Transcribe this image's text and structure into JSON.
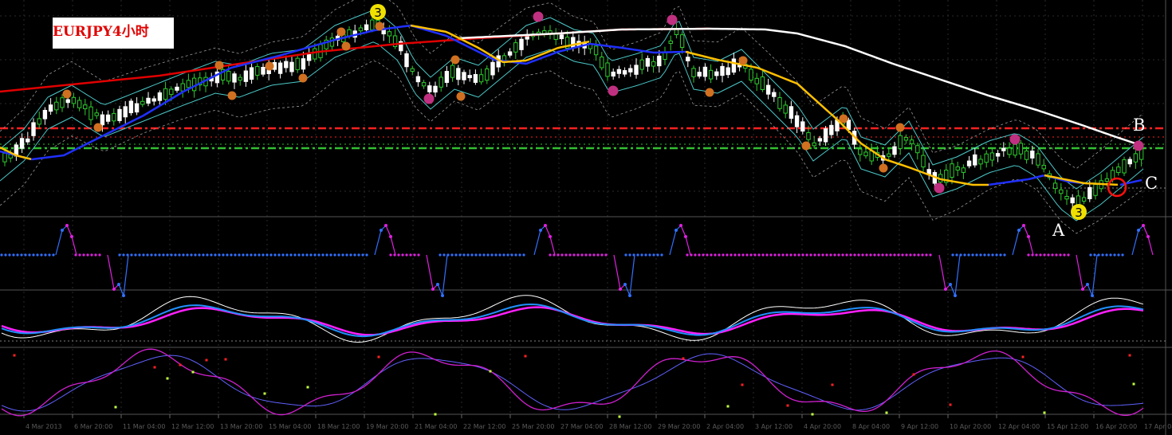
{
  "chart_title": "EURJPY4小时",
  "points": {
    "A": "A",
    "B": "B",
    "C": "C"
  },
  "wave_label": "3",
  "colors": {
    "background": "#000000",
    "bull_candle": "#2ecc2e",
    "bear_candle": "#ffffff",
    "ma_red": "#e00000",
    "ma_blue": "#2030ff",
    "ma_white": "#ffffff",
    "ma_yellow": "#ffc000",
    "band_cyan": "#4cc8c8",
    "band_outer": "#9a9a9a",
    "level_red": "#ff2020",
    "level_green": "#30c030",
    "marker_orange": "#d07020",
    "marker_pink": "#c03080",
    "marker_yellow": "#f0e000",
    "signal_blue": "#3070ff",
    "signal_magenta": "#e020e0",
    "osc_white": "#ffffff",
    "osc_blue": "#2090ff",
    "osc_magenta": "#ff20ff",
    "stoch_magenta": "#d020d0",
    "stoch_blue": "#6060ff",
    "dot_red": "#ff2020",
    "dot_yellow": "#c0ff40"
  },
  "x_ticks": [
    "4 Mar 2013",
    "6 Mar 20:00",
    "11 Mar 04:00",
    "12 Mar 12:00",
    "13 Mar 20:00",
    "15 Mar 04:00",
    "18 Mar 12:00",
    "19 Mar 20:00",
    "21 Mar 04:00",
    "22 Mar 12:00",
    "25 Mar 20:00",
    "27 Mar 04:00",
    "28 Mar 12:00",
    "29 Mar 20:00",
    "2 Apr 04:00",
    "3 Apr 12:00",
    "4 Apr 20:00",
    "8 Apr 04:00",
    "9 Apr 12:00",
    "10 Apr 20:00",
    "12 Apr 04:00",
    "15 Apr 12:00",
    "16 Apr 20:00",
    "17 Apr 04:00"
  ]
}
